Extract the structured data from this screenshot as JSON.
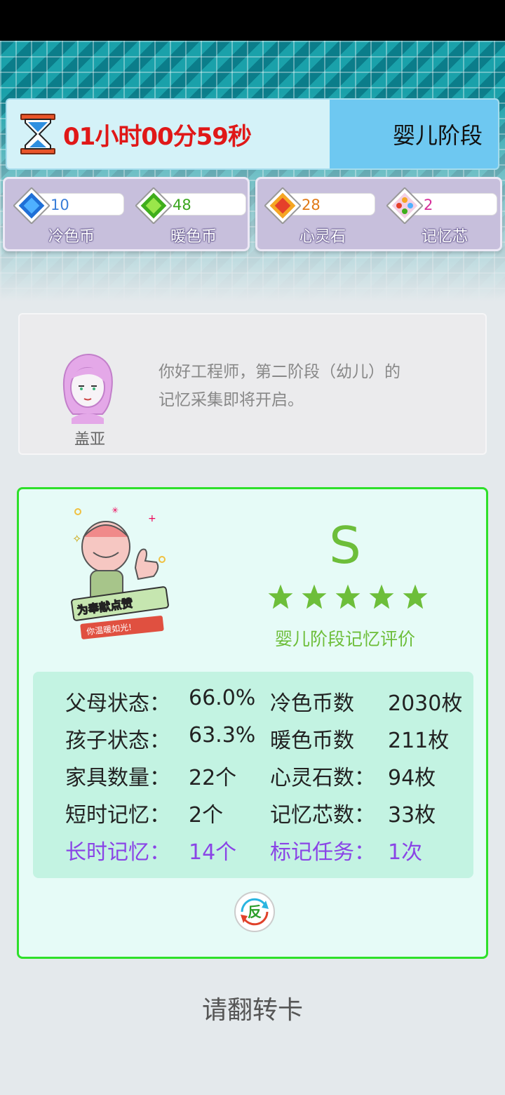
{
  "header": {
    "timer": "01小时00分59秒",
    "stage": "婴儿阶段"
  },
  "currencies": [
    {
      "value": "10",
      "label": "冷色币",
      "value_color": "#3a7ed8",
      "gem": "blue-gem-icon"
    },
    {
      "value": "48",
      "label": "暖色币",
      "value_color": "#3aa61f",
      "gem": "green-gem-icon"
    },
    {
      "value": "28",
      "label": "心灵石",
      "value_color": "#e07a18",
      "gem": "orange-gem-icon"
    },
    {
      "value": "2",
      "label": "记忆芯",
      "value_color": "#d62d9a",
      "gem": "rainbow-gem-icon"
    }
  ],
  "message": {
    "speaker": "盖亚",
    "text_line1": "你好工程师，第二阶段（幼儿）的",
    "text_line2": "记忆采集即将开启。"
  },
  "result": {
    "grade": "S",
    "stars": 5,
    "evaluation": "婴儿阶段记忆评价",
    "stats_left": [
      {
        "label": "父母状态：",
        "value": "66.0%"
      },
      {
        "label": "孩子状态：",
        "value": "63.3%"
      },
      {
        "label": "家具数量：",
        "value": "22个"
      },
      {
        "label": "短时记忆：",
        "value": "2个"
      },
      {
        "label": "长时记忆：",
        "value": "14个"
      }
    ],
    "stats_right": [
      {
        "label": "冷色币数",
        "value": "2030枚"
      },
      {
        "label": "暖色币数",
        "value": "211枚"
      },
      {
        "label": "心灵石数：",
        "value": "94枚"
      },
      {
        "label": "记忆芯数：",
        "value": "33枚"
      },
      {
        "label": "标记任务：",
        "value": "1次"
      }
    ],
    "reverse_button": "反"
  },
  "footer": {
    "flip_hint": "请翻转卡"
  },
  "colors": {
    "timer_red": "#e01818",
    "stage_blue": "#6ec8f1",
    "card_green": "#2ee02a",
    "highlight_purple": "#8a44e6"
  }
}
